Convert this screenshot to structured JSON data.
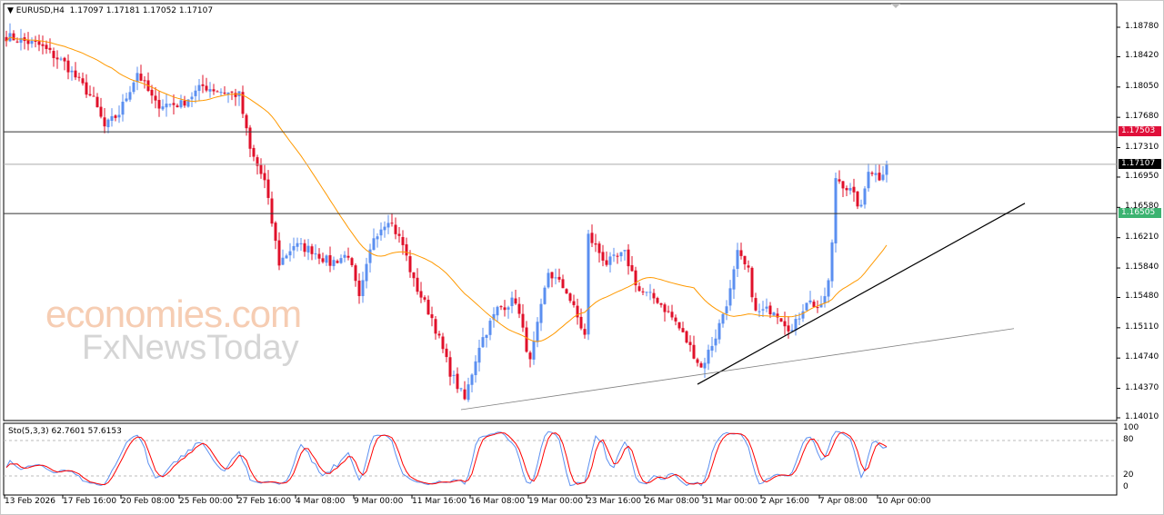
{
  "header": {
    "symbol": "EURUSD,H4",
    "ohlc": "1.17097 1.17181 1.17052 1.17107"
  },
  "watermark": {
    "line1": "economies.com",
    "line2": "FxNewsToday"
  },
  "price_axis": [
    "1.18780",
    "1.18420",
    "1.18050",
    "1.17680",
    "1.17310",
    "1.16950",
    "1.16580",
    "1.16210",
    "1.15840",
    "1.15480",
    "1.15110",
    "1.14740",
    "1.14370",
    "1.14010"
  ],
  "levels": [
    {
      "label": "1.17503",
      "price": 1.17503,
      "color": "#e0103a"
    },
    {
      "label": "1.17107",
      "price": 1.17107,
      "color": "#000000"
    },
    {
      "label": "1.16505",
      "price": 1.16505,
      "color": "#3cb371"
    }
  ],
  "stoch": {
    "label": "Sto(5,3,3) 62.7601 57.6153",
    "axis": [
      "100",
      "80",
      "20",
      "0"
    ]
  },
  "time_axis": [
    "13 Feb 2026",
    "17 Feb 16:00",
    "20 Feb 08:00",
    "25 Feb 00:00",
    "27 Feb 16:00",
    "4 Mar 08:00",
    "9 Mar 00:00",
    "11 Mar 16:00",
    "16 Mar 08:00",
    "19 Mar 00:00",
    "23 Mar 16:00",
    "26 Mar 08:00",
    "31 Mar 00:00",
    "2 Apr 16:00",
    "7 Apr 08:00",
    "10 Apr 00:00"
  ],
  "chart_data": {
    "type": "candlestick",
    "bars": 243,
    "ylim": [
      1.1401,
      1.1878
    ],
    "anchors": [
      [
        0,
        1.1867
      ],
      [
        9,
        1.1856
      ],
      [
        16,
        1.1834
      ],
      [
        24,
        1.1789
      ],
      [
        27,
        1.1756
      ],
      [
        31,
        1.1773
      ],
      [
        36,
        1.1823
      ],
      [
        41,
        1.1784
      ],
      [
        48,
        1.1784
      ],
      [
        54,
        1.1806
      ],
      [
        59,
        1.18
      ],
      [
        64,
        1.1795
      ],
      [
        67,
        1.1728
      ],
      [
        71,
        1.1689
      ],
      [
        75,
        1.159
      ],
      [
        79,
        1.1612
      ],
      [
        84,
        1.1606
      ],
      [
        89,
        1.159
      ],
      [
        94,
        1.1601
      ],
      [
        97,
        1.1545
      ],
      [
        101,
        1.1623
      ],
      [
        105,
        1.1645
      ],
      [
        109,
        1.1612
      ],
      [
        112,
        1.1567
      ],
      [
        117,
        1.1523
      ],
      [
        122,
        1.1457
      ],
      [
        126,
        1.1423
      ],
      [
        130,
        1.149
      ],
      [
        135,
        1.1534
      ],
      [
        140,
        1.1545
      ],
      [
        144,
        1.1468
      ],
      [
        149,
        1.1579
      ],
      [
        154,
        1.1556
      ],
      [
        159,
        1.1501
      ],
      [
        160,
        1.1623
      ],
      [
        165,
        1.159
      ],
      [
        170,
        1.1601
      ],
      [
        174,
        1.1556
      ],
      [
        179,
        1.1545
      ],
      [
        184,
        1.1518
      ],
      [
        189,
        1.1479
      ],
      [
        191,
        1.1462
      ],
      [
        195,
        1.1501
      ],
      [
        199,
        1.1556
      ],
      [
        201,
        1.1601
      ],
      [
        204,
        1.1579
      ],
      [
        206,
        1.1529
      ],
      [
        211,
        1.1534
      ],
      [
        216,
        1.1507
      ],
      [
        220,
        1.1545
      ],
      [
        224,
        1.1534
      ],
      [
        226,
        1.1567
      ],
      [
        227,
        1.1612
      ],
      [
        228,
        1.1695
      ],
      [
        232,
        1.1678
      ],
      [
        235,
        1.1656
      ],
      [
        237,
        1.1706
      ],
      [
        240,
        1.1695
      ],
      [
        242,
        1.1711
      ]
    ],
    "ma_period": 30,
    "trendlines": [
      {
        "from": [
          190,
          1.1442
        ],
        "to": [
          280,
          1.1663
        ],
        "color": "#000000"
      },
      {
        "from": [
          125,
          1.1411
        ],
        "to": [
          277,
          1.151
        ],
        "color": "#808080"
      }
    ],
    "colors": {
      "up": "#5b8ff0",
      "down": "#e0102a",
      "ma": "#ff9900",
      "k": "#5b8ff0",
      "d": "#ff0000"
    }
  }
}
